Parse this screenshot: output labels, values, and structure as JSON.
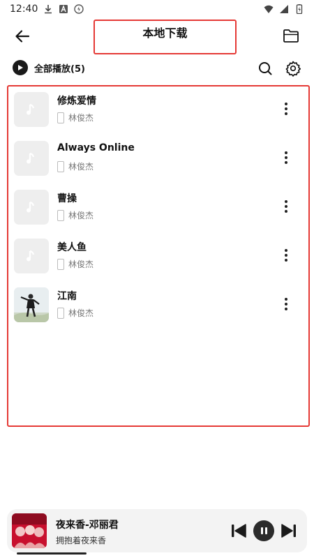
{
  "status_bar": {
    "time": "12:40"
  },
  "header": {
    "title": "本地下载"
  },
  "toolbar": {
    "play_all_label": "全部播放(5)"
  },
  "songs": [
    {
      "title": "修炼爱情",
      "artist": "林俊杰",
      "has_cover": false
    },
    {
      "title": "Always Online",
      "artist": "林俊杰",
      "has_cover": false
    },
    {
      "title": "曹操",
      "artist": "林俊杰",
      "has_cover": false
    },
    {
      "title": "美人鱼",
      "artist": "林俊杰",
      "has_cover": false
    },
    {
      "title": "江南",
      "artist": "林俊杰",
      "has_cover": true
    }
  ],
  "player": {
    "title": "夜来香-邓丽君",
    "subtitle": "拥抱着夜来香",
    "progress": 0.24
  },
  "colors": {
    "highlight": "#e53935",
    "text": "#111111",
    "muted": "#777777"
  },
  "icons": [
    "back-arrow-icon",
    "folder-icon",
    "play-icon",
    "search-icon",
    "gear-icon",
    "music-note-icon",
    "phone-icon",
    "more-vert-icon",
    "skip-previous-icon",
    "pause-icon",
    "skip-next-icon"
  ]
}
